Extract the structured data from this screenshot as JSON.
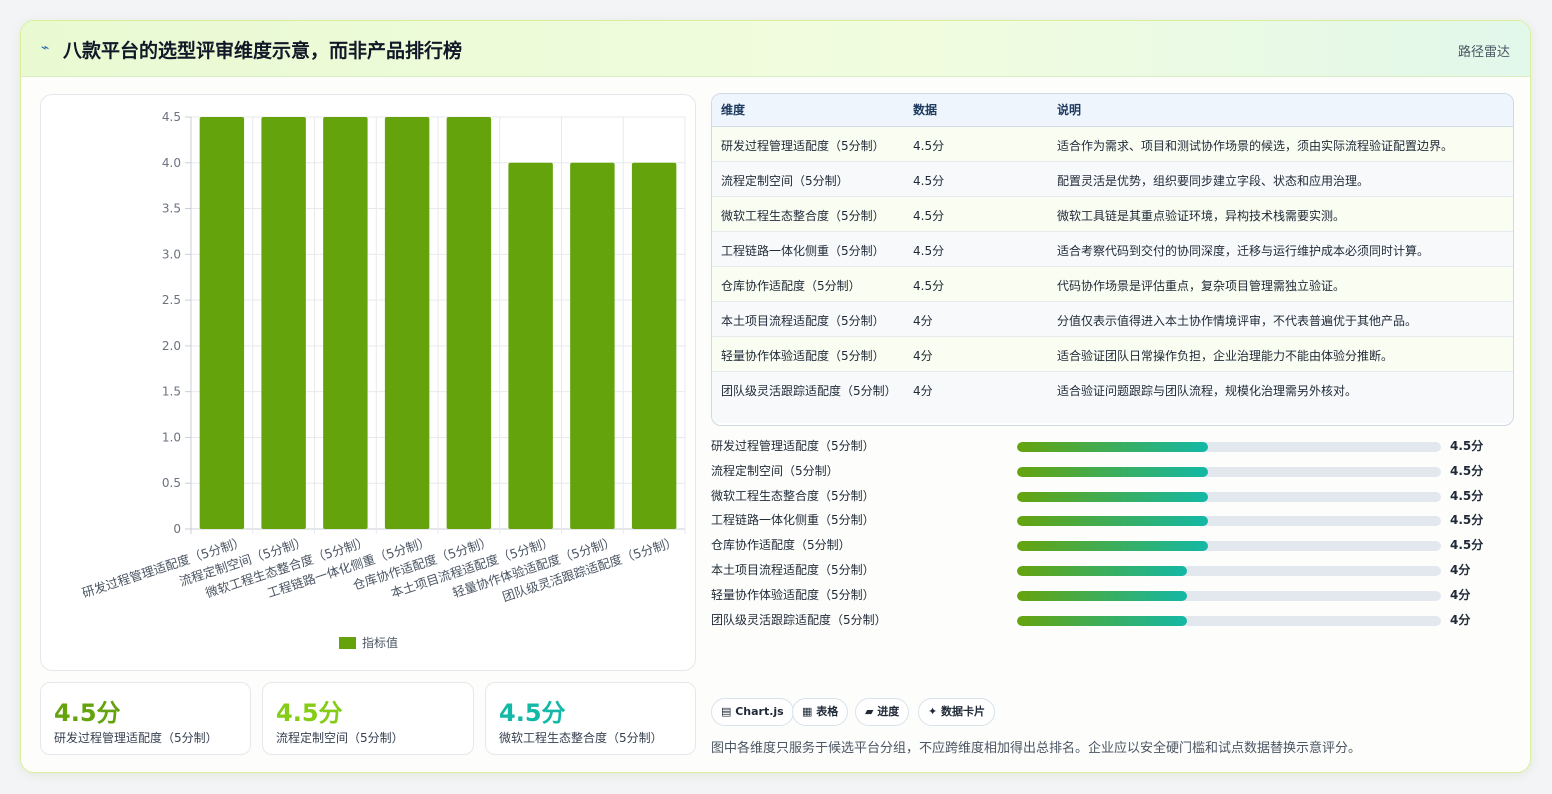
{
  "header": {
    "icon": "⌁",
    "title": "八款平台的选型评审维度示意，而非产品排行榜",
    "link": "路径雷达"
  },
  "chart_data": {
    "type": "bar",
    "categories": [
      "研发过程管理适配度（5分制）",
      "流程定制空间（5分制）",
      "微软工程生态整合度（5分制）",
      "工程链路一体化侧重（5分制）",
      "仓库协作适配度（5分制）",
      "本土项目流程适配度（5分制）",
      "轻量协作体验适配度（5分制）",
      "团队级灵活跟踪适配度（5分制）"
    ],
    "series": [
      {
        "name": "指标值",
        "values": [
          4.5,
          4.5,
          4.5,
          4.5,
          4.5,
          4,
          4,
          4
        ]
      }
    ],
    "ylim": [
      0,
      4.5
    ],
    "yticks": [
      "0",
      "0.5",
      "1.0",
      "1.5",
      "2.0",
      "2.5",
      "3.0",
      "3.5",
      "4.0",
      "4.5"
    ],
    "bar_color": "#65a30d",
    "grid": true,
    "legend": "bottom"
  },
  "table": {
    "headers": [
      "维度",
      "数据",
      "说明"
    ],
    "rows": [
      [
        "研发过程管理适配度（5分制）",
        "4.5分",
        "适合作为需求、项目和测试协作场景的候选，须由实际流程验证配置边界。"
      ],
      [
        "流程定制空间（5分制）",
        "4.5分",
        "配置灵活是优势，组织要同步建立字段、状态和应用治理。"
      ],
      [
        "微软工程生态整合度（5分制）",
        "4.5分",
        "微软工具链是其重点验证环境，异构技术栈需要实测。"
      ],
      [
        "工程链路一体化侧重（5分制）",
        "4.5分",
        "适合考察代码到交付的协同深度，迁移与运行维护成本必须同时计算。"
      ],
      [
        "仓库协作适配度（5分制）",
        "4.5分",
        "代码协作场景是评估重点，复杂项目管理需独立验证。"
      ],
      [
        "本土项目流程适配度（5分制）",
        "4分",
        "分值仅表示值得进入本土协作情境评审，不代表普遍优于其他产品。"
      ],
      [
        "轻量协作体验适配度（5分制）",
        "4分",
        "适合验证团队日常操作负担，企业治理能力不能由体验分推断。"
      ],
      [
        "团队级灵活跟踪适配度（5分制）",
        "4分",
        "适合验证问题跟踪与团队流程，规模化治理需另外核对。"
      ]
    ]
  },
  "progress": [
    {
      "label": "研发过程管理适配度（5分制）",
      "value": 4.5,
      "display": "4.5分"
    },
    {
      "label": "流程定制空间（5分制）",
      "value": 4.5,
      "display": "4.5分"
    },
    {
      "label": "微软工程生态整合度（5分制）",
      "value": 4.5,
      "display": "4.5分"
    },
    {
      "label": "工程链路一体化侧重（5分制）",
      "value": 4.5,
      "display": "4.5分"
    },
    {
      "label": "仓库协作适配度（5分制）",
      "value": 4.5,
      "display": "4.5分"
    },
    {
      "label": "本土项目流程适配度（5分制）",
      "value": 4,
      "display": "4分"
    },
    {
      "label": "轻量协作体验适配度（5分制）",
      "value": 4,
      "display": "4分"
    },
    {
      "label": "团队级灵活跟踪适配度（5分制）",
      "value": 4,
      "display": "4分"
    }
  ],
  "progress_max": 10,
  "kpis": [
    {
      "value": "4.5分",
      "label": "研发过程管理适配度（5分制）",
      "color": "#65a30d"
    },
    {
      "value": "4.5分",
      "label": "流程定制空间（5分制）",
      "color": "#84cc16"
    },
    {
      "value": "4.5分",
      "label": "微软工程生态整合度（5分制）",
      "color": "#14b8a6"
    }
  ],
  "chips": [
    "▤ Chart.js",
    "▦ 表格",
    "▰ 进度",
    "✦ 数据卡片"
  ],
  "footnote": "图中各维度只服务于候选平台分组，不应跨维度相加得出总排名。企业应以安全硬门槛和试点数据替换示意评分。"
}
